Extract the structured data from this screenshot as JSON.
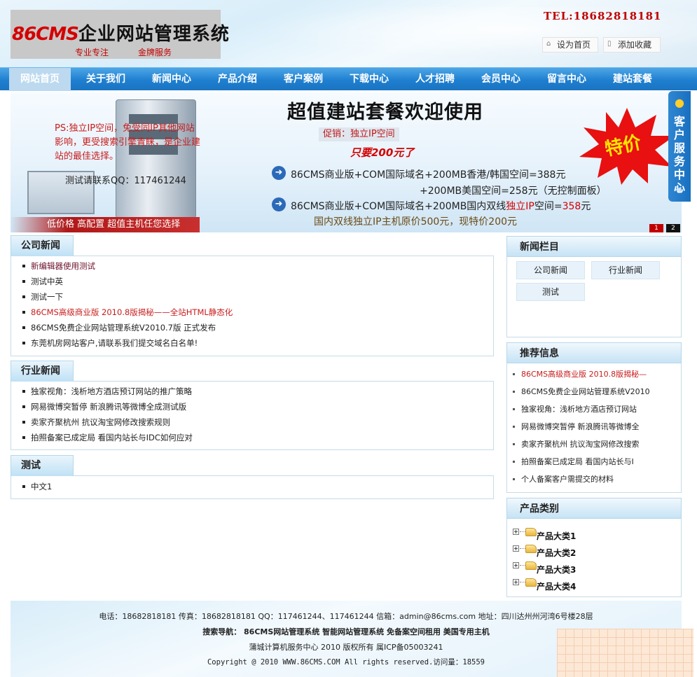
{
  "header": {
    "logo_brand": "86CMS",
    "logo_title": "企业网站管理系统",
    "logo_tagline_1": "专业专注",
    "logo_tagline_2": "金牌服务",
    "tel": "TEL:18682818181",
    "set_home_label": "设为首页",
    "add_favorite_label": "添加收藏"
  },
  "nav": {
    "items": [
      "网站首页",
      "关于我们",
      "新闻中心",
      "产品介绍",
      "客户案例",
      "下载中心",
      "人才招聘",
      "会员中心",
      "留言中心",
      "建站套餐"
    ],
    "active_index": 0
  },
  "banner": {
    "ps_text": "PS:独立IP空间，免受同IP其他网站影响，更受搜索引擎青睐，是企业建站的最佳选择。",
    "qq_text": "测试请联系QQ：117461244",
    "low_price_text": "低价格 高配置 超值主机任您选择",
    "title": "超值建站套餐欢迎使用",
    "promo": "促销：独立IP空间",
    "price": "只要200元了",
    "line1": "86CMS商业版+COM国际域名+200MB香港/韩国空间=388元",
    "line2": "+200MB美国空间=258元（无控制面板）",
    "line3_a": "86CMS商业版+COM国际域名+200MB国内双线",
    "line3_b": "独立IP",
    "line3_c": "空间=",
    "line3_d": "358",
    "line3_e": "元",
    "line4": "国内双线独立IP主机原价500元，现特价200元",
    "burst": "特价",
    "pager": [
      "1",
      "2"
    ]
  },
  "customer_service": {
    "label": "客户服务中心"
  },
  "company_news": {
    "title": "公司新闻",
    "items": [
      "新编辑器使用测试",
      "测试中英",
      "测试一下",
      "86CMS高级商业版 2010.8版揭秘——全站HTML静态化",
      "86CMS免费企业网站管理系统V2010.7版 正式发布",
      "东莞机房网站客户,请联系我们提交域名白名单!"
    ]
  },
  "industry_news": {
    "title": "行业新闻",
    "items": [
      "独家视角：浅析地方酒店预订网站的推广策略",
      "网易微博突暂停 新浪腾讯等微博全成测试版",
      "卖家齐聚杭州 抗议淘宝网修改搜索规则",
      "拍照备案已成定局 看国内站长与IDC如何应对"
    ]
  },
  "test_section": {
    "title": "测试",
    "items": [
      "中文1"
    ]
  },
  "news_categories": {
    "title": "新闻栏目",
    "buttons": [
      "公司新闻",
      "行业新闻",
      "测试"
    ]
  },
  "recommended": {
    "title": "推荐信息",
    "items": [
      "86CMS高级商业版 2010.8版揭秘—",
      "86CMS免费企业网站管理系统V2010",
      "独家视角：浅析地方酒店预订网站",
      "网易微博突暂停 新浪腾讯等微博全",
      "卖家齐聚杭州 抗议淘宝网修改搜索",
      "拍照备案已成定局 看国内站长与I",
      "个人备案客户需提交的材料"
    ]
  },
  "product_categories": {
    "title": "产品类别",
    "items": [
      "产品大类1",
      "产品大类2",
      "产品大类3",
      "产品大类4"
    ]
  },
  "footer": {
    "contact": "电话：18682818181 传真：18682818181 QQ：117461244、117461244 信箱：admin@86cms.com 地址：四川达州州河湾6号楼28层",
    "search_nav": "搜索导航：  86CMS网站管理系统 智能网站管理系统 免备案空间租用 美国专用主机",
    "copyright_cn": "蒲城计算机服务中心 2010 版权所有 属ICP备05003241",
    "copyright_en": "Copyright @ 2010 WWW.86CMS.COM All rights reserved.访问量：18559"
  },
  "colors": {
    "nav_blue": "#1f7fd0",
    "accent_red": "#d40000",
    "panel_border": "#c5dbe8"
  }
}
